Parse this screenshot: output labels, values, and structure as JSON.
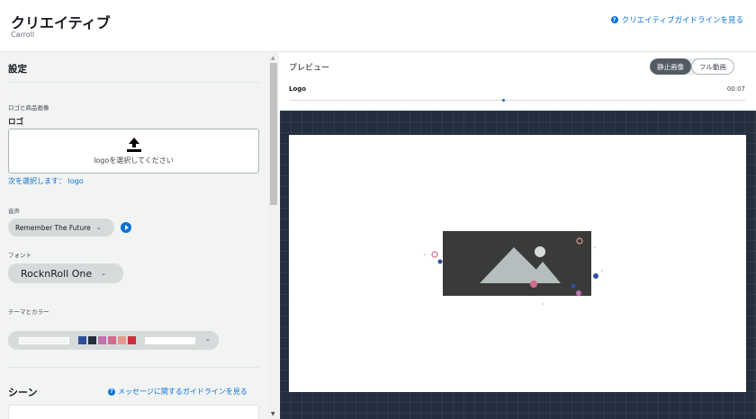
{
  "header": {
    "title": "クリエイティブ",
    "subtitle": "Carroll",
    "guide_link": "クリエイティブガイドラインを見る"
  },
  "settings": {
    "title": "設定",
    "logo_section_label": "ロゴと商品画像",
    "logo_label": "ロゴ",
    "upload_text": "logoを選択してください",
    "selected_text": "次を選択します： logo",
    "audio_label": "音声",
    "audio_value": "Remember The Future",
    "font_label": "フォント",
    "font_value": "RocknRoll One",
    "theme_label": "テーマとカラー",
    "theme_swatches": [
      "#2e4f9c",
      "#232f3e",
      "#c46fb0",
      "#d36a8f",
      "#e39a8a",
      "#cc2f3e"
    ]
  },
  "scenes": {
    "title": "シーン",
    "guide_link": "メッセージに関するガイドラインを見る"
  },
  "preview": {
    "title": "プレビュー",
    "mode_still": "静止画像",
    "mode_full": "フル動画",
    "timeline_label": "Logo",
    "timeline_time": "00:07",
    "placeholder_bg": "#3a3a3a",
    "placeholder_fg": "#b5bdbf"
  },
  "colors": {
    "accent": "#0972d3",
    "canvas_bg": "#232f3e"
  }
}
